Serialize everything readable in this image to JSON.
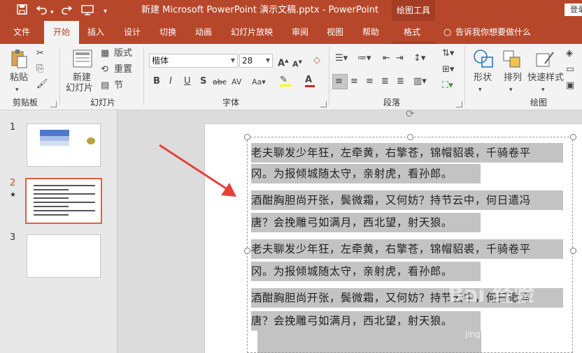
{
  "window": {
    "title": "新建 Microsoft PowerPoint 演示文稿.pptx  -  PowerPoint",
    "context_tools": "绘图工具",
    "signin": "登录"
  },
  "quick_access": {
    "save_icon": "save-icon",
    "undo_icon": "undo-icon",
    "redo_icon": "redo-icon",
    "present_icon": "presentation-icon",
    "customize_icon": "customize-icon"
  },
  "tabs": [
    {
      "label": "文件"
    },
    {
      "label": "开始",
      "active": true
    },
    {
      "label": "插入"
    },
    {
      "label": "设计"
    },
    {
      "label": "切换"
    },
    {
      "label": "动画"
    },
    {
      "label": "幻灯片放映"
    },
    {
      "label": "审阅"
    },
    {
      "label": "视图"
    },
    {
      "label": "帮助"
    },
    {
      "label": "格式"
    }
  ],
  "tell_me": "告诉我你想要做什么",
  "ribbon": {
    "clipboard": {
      "label": "剪贴板",
      "paste": "粘贴"
    },
    "slides": {
      "label": "幻灯片",
      "new_slide": "新建",
      "new_slide2": "幻灯片",
      "layout": "版式",
      "reset": "重置",
      "section": "节"
    },
    "font": {
      "label": "字体",
      "name": "楷体",
      "size": "28",
      "bold": "B",
      "italic": "I",
      "underline": "U",
      "shadow": "S",
      "strike": "abc",
      "spacing": "AV"
    },
    "paragraph": {
      "label": "段落"
    },
    "drawing": {
      "label": "绘图",
      "shapes": "形状",
      "arrange": "排列",
      "quick_styles": "快速样式"
    }
  },
  "slides_panel": [
    {
      "number": "1"
    },
    {
      "number": "2",
      "starred": "★"
    },
    {
      "number": "3"
    }
  ],
  "slide_text": [
    "老夫聊发少年狂，左牵黄，右擎苍，锦帽貂裘，千骑卷平",
    "冈。为报倾城随太守，亲射虎，看孙郎。",
    "酒酣胸胆尚开张，鬓微霜，又何妨？持节云中，何日遣冯",
    "唐？会挽雕弓如满月，西北望，射天狼。",
    "老夫聊发少年狂，左牵黄，右擎苍，锦帽貂裘，千骑卷平",
    "冈。为报倾城随太守，亲射虎，看孙郎。",
    "酒酣胸胆尚开张，鬓微霜，又何妨？持节云中，何日遣冯",
    "唐？会挽雕弓如满月，西北望，射天狼。"
  ],
  "watermark": {
    "text": "Bai 经验",
    "url": "jingyan.baidu.com"
  },
  "colors": {
    "brand": "#b7472a",
    "arrow": "#e8413c",
    "selection": "#c3c3c3"
  }
}
